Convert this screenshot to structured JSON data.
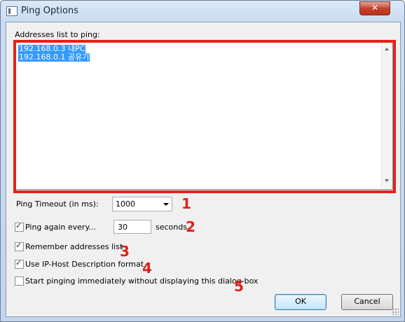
{
  "window": {
    "title": "Ping Options",
    "close_label": "✕"
  },
  "addresses": {
    "label": "Addresses list to ping:",
    "lines": [
      "192.168.0.3 내PC",
      "192.168.0.1 공유기"
    ]
  },
  "timeout": {
    "label": "Ping Timeout (in ms):",
    "value": "1000"
  },
  "ping_again": {
    "label": "Ping again every...",
    "checked": true,
    "value": "30",
    "unit": "seconds"
  },
  "remember": {
    "label": "Remember addresses list",
    "checked": true
  },
  "ip_host": {
    "label": "Use IP-Host Description format",
    "checked": true
  },
  "start_immediately": {
    "label": "Start pinging immediately without displaying this dialog-box",
    "checked": false
  },
  "annotations": [
    "1",
    "2",
    "3",
    "4",
    "5"
  ],
  "buttons": {
    "ok": "OK",
    "cancel": "Cancel"
  },
  "colors": {
    "annotation_red": "#e2231a",
    "selection_blue": "#3399ff"
  }
}
